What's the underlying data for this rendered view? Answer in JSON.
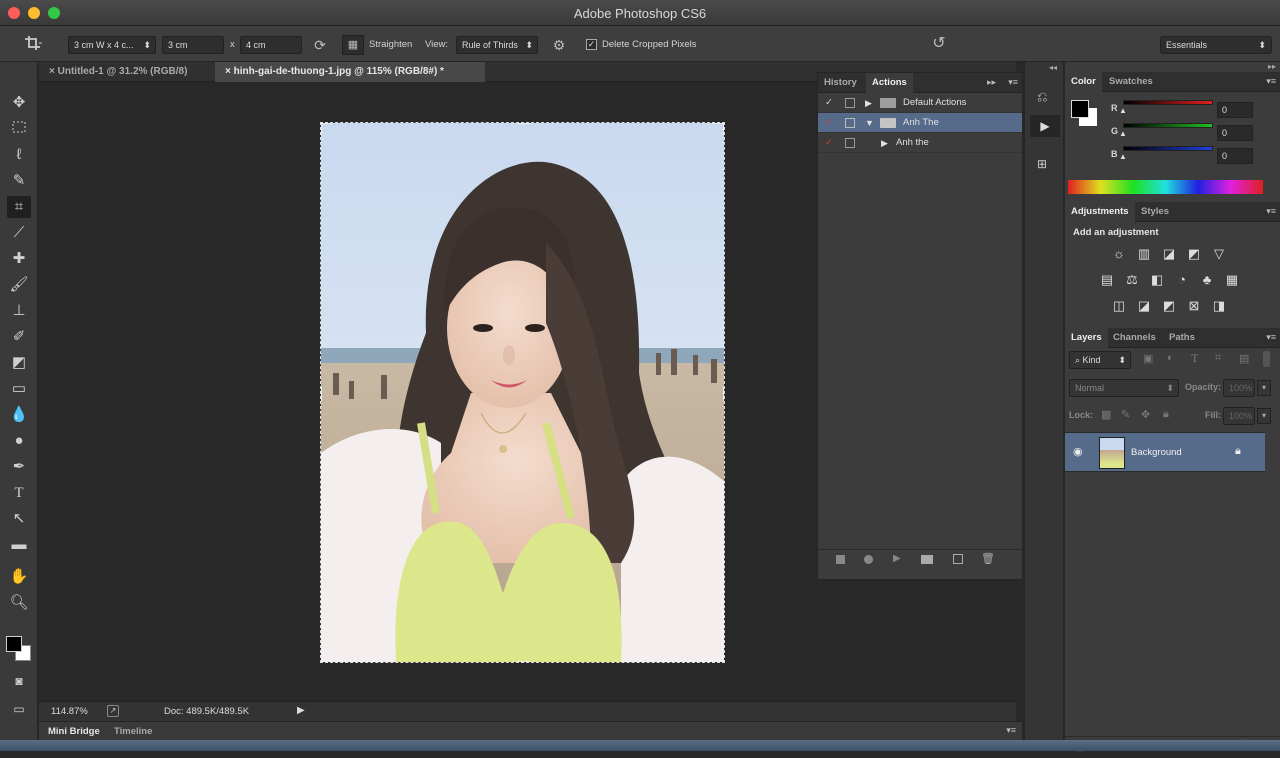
{
  "window": {
    "title": "Adobe Photoshop CS6",
    "traffic_lights": [
      "#fc5e57",
      "#fdbd2f",
      "#33c748"
    ]
  },
  "options_bar": {
    "preset": "3 cm W x 4 c...",
    "width": "3 cm",
    "x_sep": "x",
    "height": "4 cm",
    "straighten_label": "Straighten",
    "view_label": "View:",
    "view_value": "Rule of Thirds",
    "delete_cropped_label": "Delete Cropped Pixels",
    "delete_cropped_checked": true,
    "workspace": "Essentials"
  },
  "tabs": [
    {
      "label": "Untitled-1 @ 31.2% (RGB/8)",
      "active": false
    },
    {
      "label": "hinh-gai-de-thuong-1.jpg @ 115% (RGB/8#) *",
      "active": true
    }
  ],
  "status": {
    "zoom": "114.87%",
    "doc": "Doc: 489.5K/489.5K"
  },
  "bottom_tabs": [
    "Mini Bridge",
    "Timeline"
  ],
  "actions_panel": {
    "tabs": [
      "History",
      "Actions"
    ],
    "active_tab": "Actions",
    "rows": [
      {
        "label": "Default Actions",
        "type": "set",
        "expanded": false,
        "check_color": "#d0d0d0",
        "selected": false
      },
      {
        "label": "Anh The",
        "type": "set",
        "expanded": true,
        "check_color": "#d43a3a",
        "selected": true
      },
      {
        "label": "Anh the",
        "type": "action",
        "expanded": false,
        "check_color": "#d43a3a",
        "selected": false
      }
    ]
  },
  "color_panel": {
    "tabs": [
      "Color",
      "Swatches"
    ],
    "channels": [
      {
        "label": "R",
        "value": "0",
        "color": "#e02020"
      },
      {
        "label": "G",
        "value": "0",
        "color": "#20c020"
      },
      {
        "label": "B",
        "value": "0",
        "color": "#2040e0"
      }
    ]
  },
  "adjustments_panel": {
    "tabs": [
      "Adjustments",
      "Styles"
    ],
    "heading": "Add an adjustment"
  },
  "layers_panel": {
    "tabs": [
      "Layers",
      "Channels",
      "Paths"
    ],
    "kind": "Kind",
    "blend_mode": "Normal",
    "opacity_label": "Opacity:",
    "opacity_value": "100%",
    "lock_label": "Lock:",
    "fill_label": "Fill:",
    "fill_value": "100%",
    "layers": [
      {
        "name": "Background",
        "locked": true,
        "visible": true
      }
    ]
  }
}
